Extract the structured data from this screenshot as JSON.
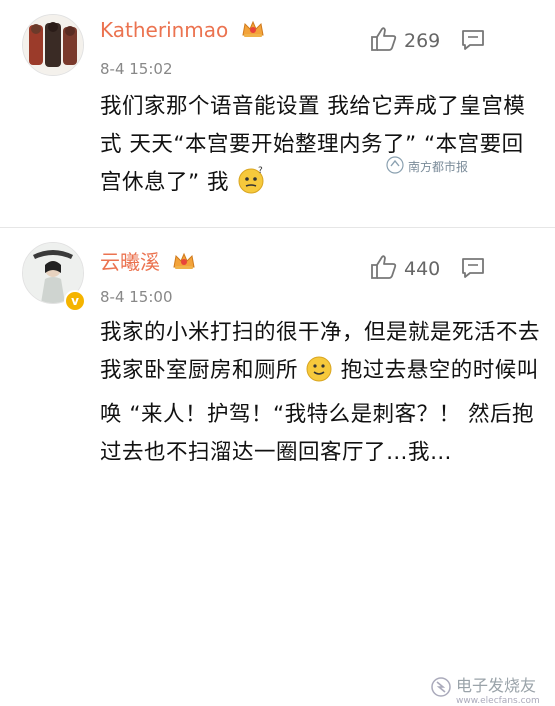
{
  "comments": [
    {
      "username": "Katherinmao",
      "timestamp": "8-4 15:02",
      "likes": "269",
      "text": "我们家那个语音能设置 我给它弄成了皇宫模式 天天“本宫要开始整理内务了” “本宫要回宫休息了” 我"
    },
    {
      "username": "云曦溪",
      "timestamp": "8-4 15:00",
      "likes": "440",
      "text_a": "我家的小米打扫的很干净，但是就是死活不去我家卧室厨房和厕所",
      "text_b": "抱过去悬空的时候叫唤 “来人！护驾！“我特么是刺客？！ 然后抱过去也不扫溜达一圈回客厅了…我…"
    }
  ],
  "watermarks": {
    "top": "南方都市报",
    "bottom": "电子发烧友",
    "bottom_sub": "www.elecfans.com"
  },
  "icons": {
    "like": "thumbs-up-icon",
    "reply": "comment-bubble-icon",
    "crown": "vip-crown-icon",
    "verified": "verified-badge-icon"
  },
  "colors": {
    "username": "#eb7350",
    "timestamp": "#888888",
    "text": "#111111"
  }
}
